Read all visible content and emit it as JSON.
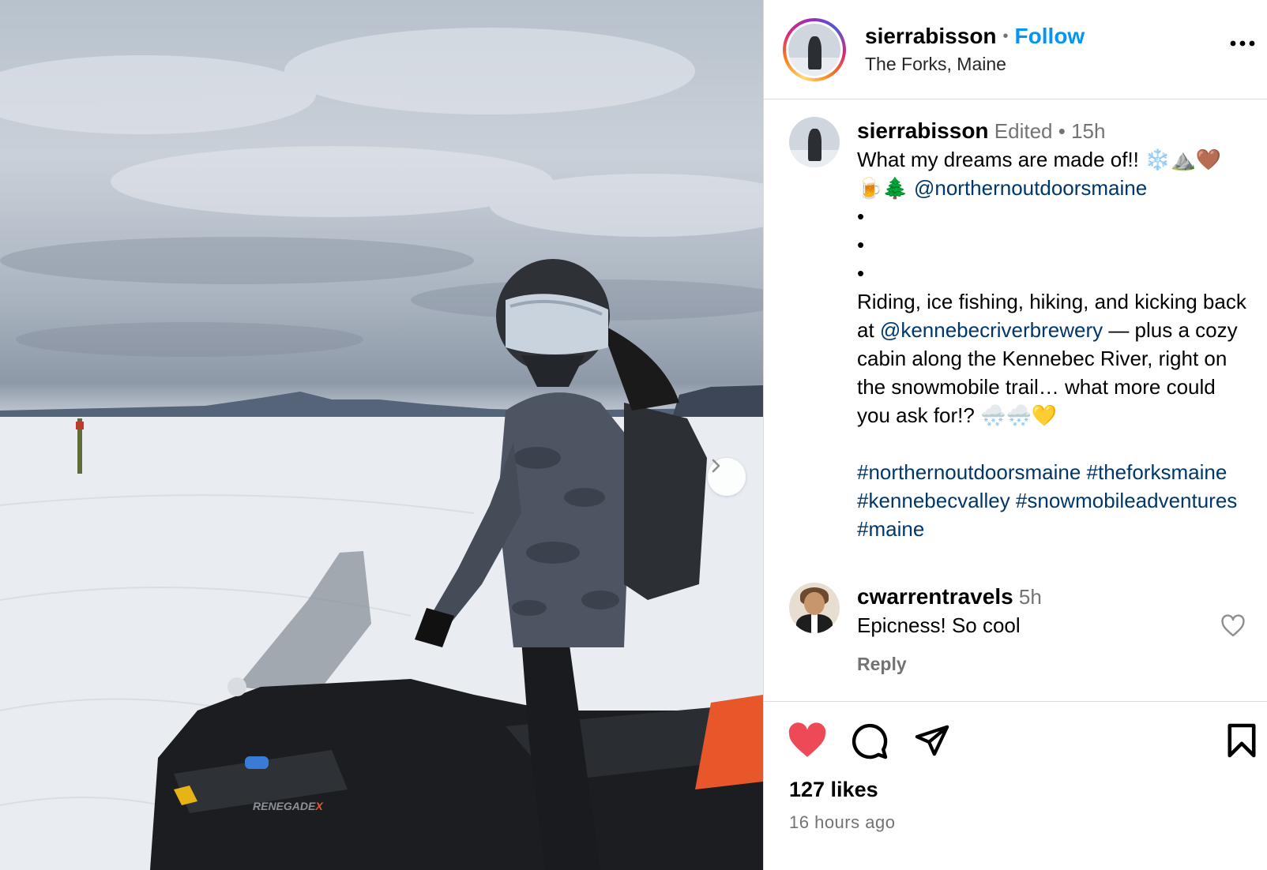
{
  "post": {
    "username": "sierrabisson",
    "separator": "•",
    "follow_label": "Follow",
    "location": "The Forks, Maine"
  },
  "caption": {
    "username": "sierrabisson",
    "edited": "Edited",
    "separator": "•",
    "time": "15h",
    "line1": "What my dreams are made of!! ❄️⛰️🤎",
    "line2_emoji": "🍺🌲 ",
    "mention1": "@northernoutdoorsmaine",
    "dot": "•",
    "body_a": "Riding, ice fishing, hiking, and kicking back at ",
    "mention2": "@kennebecriverbrewery",
    "body_b": " — plus a cozy cabin along the Kennebec River, right on the snowmobile trail… what more could you ask for!? 🌨️🌨️💛",
    "hashtags": "#northernoutdoorsmaine #theforksmaine #kennebecvalley #snowmobileadventures #maine"
  },
  "comment": {
    "username": "cwarrentravels",
    "time": "5h",
    "text": "Epicness! So cool",
    "reply_label": "Reply"
  },
  "footer": {
    "likes": "127 likes",
    "posted": "16 hours ago"
  },
  "photo": {
    "brand_text": "RENEGADE",
    "brand_text_x": "X"
  },
  "colors": {
    "like": "#ed4956",
    "follow": "#0095f6",
    "link": "#00376b",
    "muted": "#737373"
  },
  "icons": {
    "more": "more-horizontal-icon",
    "next": "chevron-right-icon",
    "like": "heart-filled-icon",
    "comment": "comment-bubble-icon",
    "share": "paper-plane-icon",
    "save": "bookmark-icon"
  }
}
